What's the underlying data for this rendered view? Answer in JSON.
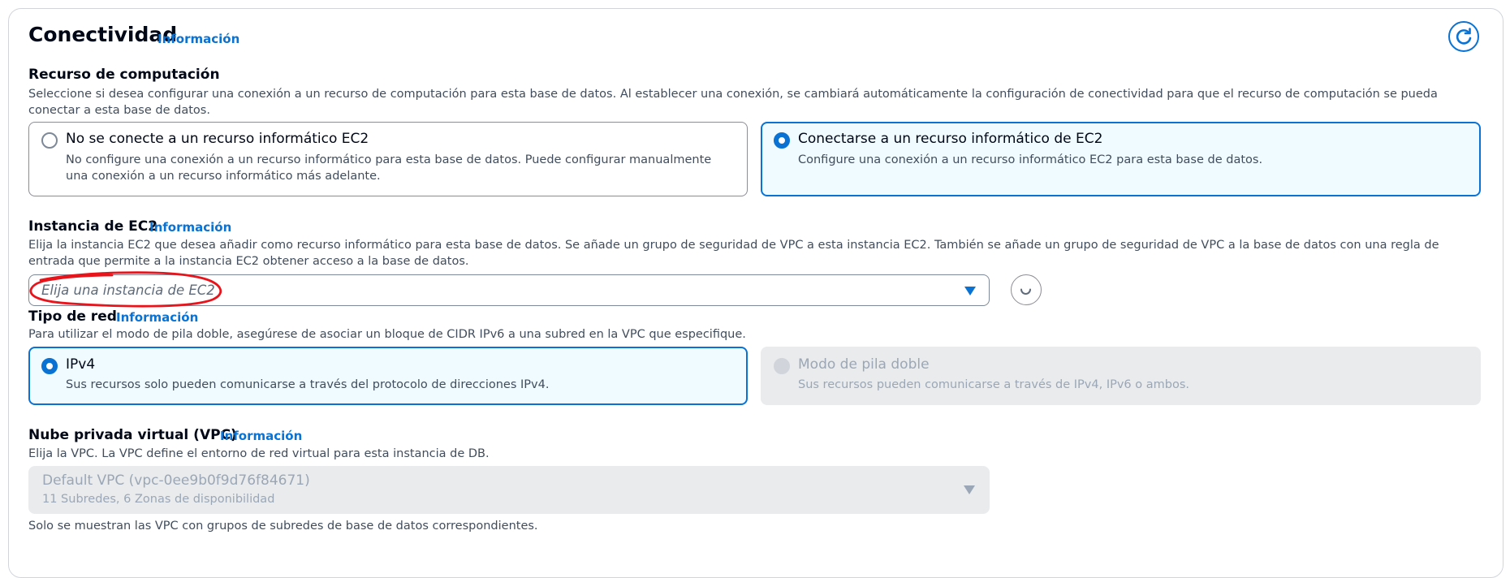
{
  "section": {
    "title": "Conectividad",
    "info_link": "Información"
  },
  "compute": {
    "label": "Recurso de computación",
    "description": "Seleccione si desea configurar una conexión a un recurso de computación para esta base de datos. Al establecer una conexión, se cambiará automáticamente la configuración de conectividad para que el recurso de computación se pueda conectar a esta base de datos.",
    "options": [
      {
        "title": "No se conecte a un recurso informático EC2",
        "description": "No configure una conexión a un recurso informático para esta base de datos. Puede configurar manualmente una conexión a un recurso informático más adelante.",
        "selected": false
      },
      {
        "title": "Conectarse a un recurso informático de EC2",
        "description": "Configure una conexión a un recurso informático EC2 para esta base de datos.",
        "selected": true
      }
    ]
  },
  "ec2_instance": {
    "label": "Instancia de EC2",
    "info_link": "Información",
    "description": "Elija la instancia EC2 que desea añadir como recurso informático para esta base de datos. Se añade un grupo de seguridad de VPC a esta instancia EC2. También se añade un grupo de seguridad de VPC a la base de datos con una regla de entrada que permite a la instancia EC2 obtener acceso a la base de datos.",
    "placeholder": "Elija una instancia de EC2"
  },
  "network_type": {
    "label": "Tipo de red",
    "info_link": "Información",
    "description": "Para utilizar el modo de pila doble, asegúrese de asociar un bloque de CIDR IPv6 a una subred en la VPC que especifique.",
    "options": [
      {
        "title": "IPv4",
        "description": "Sus recursos solo pueden comunicarse a través del protocolo de direcciones IPv4.",
        "selected": true,
        "disabled": false
      },
      {
        "title": "Modo de pila doble",
        "description": "Sus recursos pueden comunicarse a través de IPv4, IPv6 o ambos.",
        "selected": false,
        "disabled": true
      }
    ]
  },
  "vpc": {
    "label": "Nube privada virtual (VPC)",
    "info_link": "Información",
    "description": "Elija la VPC. La VPC define el entorno de red virtual para esta instancia de DB.",
    "selected_value": "Default VPC (vpc-0ee9b0f9d76f84671)",
    "selected_detail": "11 Subredes, 6 Zonas de disponibilidad",
    "footnote": "Solo se muestran las VPC con grupos de subredes de base de datos correspondientes."
  },
  "colors": {
    "accent": "#0972d3",
    "selected_card_bg": "#f0fbff",
    "disabled_bg": "#e9ebed",
    "annotation": "#e8141c"
  },
  "icons": {
    "refresh": "refresh-icon",
    "loading": "spinner-icon",
    "dropdown": "caret-down-icon"
  }
}
